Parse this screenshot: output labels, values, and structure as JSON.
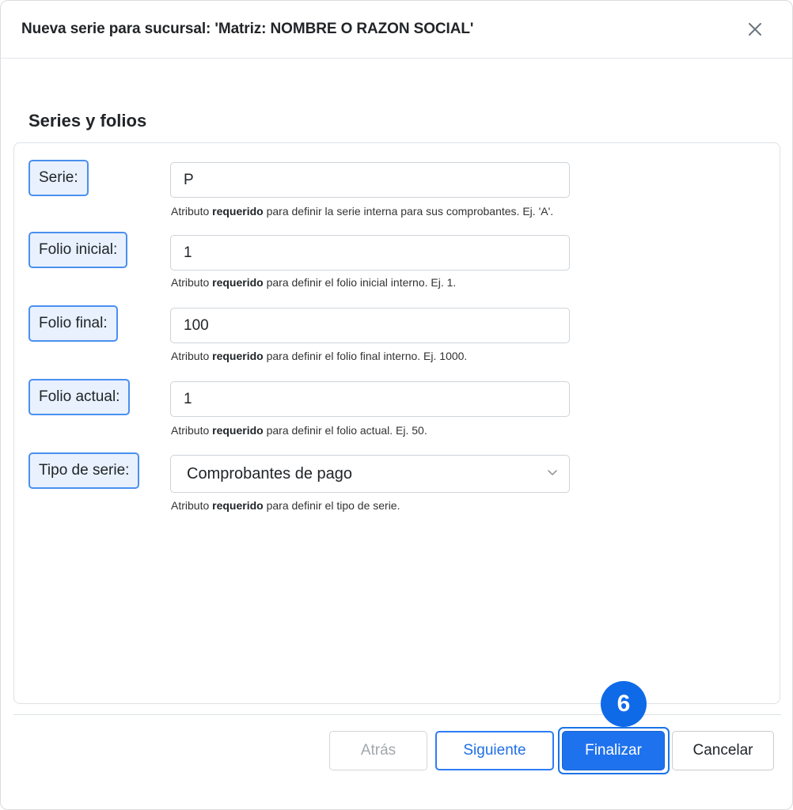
{
  "dialog": {
    "title": "Nueva serie para sucursal: 'Matriz: NOMBRE O RAZON SOCIAL'",
    "close_icon": "close-icon"
  },
  "section": {
    "title": "Series y folios"
  },
  "fields": {
    "serie": {
      "label": "Serie:",
      "value": "P",
      "help_prefix": "Atributo ",
      "help_bold": "requerido",
      "help_suffix": " para definir la serie interna para sus comprobantes. Ej. 'A'."
    },
    "folio_inicial": {
      "label": "Folio inicial:",
      "value": "1",
      "help_prefix": "Atributo ",
      "help_bold": "requerido",
      "help_suffix": " para definir el folio inicial interno. Ej. 1."
    },
    "folio_final": {
      "label": "Folio final:",
      "value": "100",
      "help_prefix": "Atributo ",
      "help_bold": "requerido",
      "help_suffix": " para definir el folio final interno. Ej. 1000."
    },
    "folio_actual": {
      "label": "Folio actual:",
      "value": "1",
      "help_prefix": "Atributo ",
      "help_bold": "requerido",
      "help_suffix": " para definir el folio actual. Ej. 50."
    },
    "tipo_serie": {
      "label": "Tipo de serie:",
      "value": "Comprobantes de pago",
      "help_prefix": "Atributo ",
      "help_bold": "requerido",
      "help_suffix": " para definir el tipo de serie."
    }
  },
  "footer": {
    "back_label": "Atrás",
    "next_label": "Siguiente",
    "finish_label": "Finalizar",
    "cancel_label": "Cancelar"
  },
  "annotation": {
    "step_number": "6"
  },
  "colors": {
    "accent": "#1f72ee",
    "label_highlight_bg": "#e8f1fd",
    "label_highlight_border": "#4a90f0",
    "badge": "#0f6ae8"
  }
}
